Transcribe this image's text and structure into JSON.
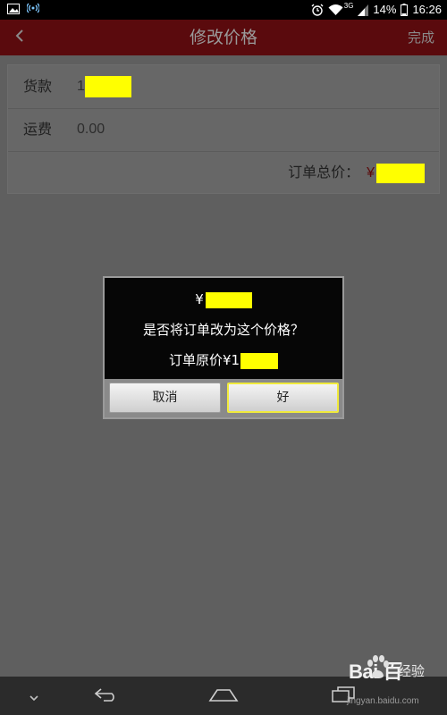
{
  "status_bar": {
    "network_type": "3G",
    "battery": "14%",
    "time": "16:26"
  },
  "title_bar": {
    "title": "修改价格",
    "done_label": "完成"
  },
  "form": {
    "goods_label": "货款",
    "goods_value_prefix": "1",
    "shipping_label": "运费",
    "shipping_value": "0.00",
    "total_label": "订单总价：",
    "total_currency": "¥"
  },
  "dialog": {
    "new_price_currency": "¥",
    "question": "是否将订单改为这个价格？",
    "original_price_label": "订单原价¥1",
    "cancel_label": "取消",
    "ok_label": "好"
  },
  "watermark": {
    "brand": "Bai  百",
    "sub": "经验",
    "url": "jingyan.baidu.com"
  },
  "colors": {
    "title_bar": "#5a0a0d",
    "overlay": "#5f5f5f",
    "redaction": "#ffff00",
    "dialog_bg": "#060606",
    "ok_focus_border": "#f0ea3c"
  }
}
